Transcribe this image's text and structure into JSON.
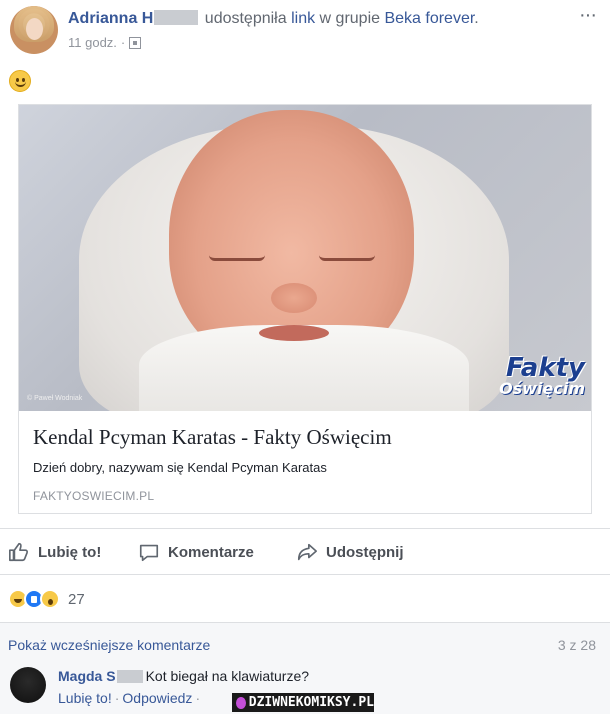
{
  "post": {
    "author": "Adrianna H",
    "verb_before_link": " udostępniła ",
    "link_word": "link",
    "in_group": " w grupie ",
    "group_name": "Beka forever",
    "group_suffix": ".",
    "time": "11 godz.",
    "time_sep": "·",
    "more": "···"
  },
  "link_card": {
    "title": "Kendal Pcyman Karatas - Fakty Oświęcim",
    "description": "Dzień dobry, nazywam się Kendal Pcyman Karatas",
    "domain": "FAKTYOSWIECIM.PL",
    "photo_credit": "© Paweł Wodniak",
    "brand_top": "Fakty",
    "brand_bottom": "Oświęcim"
  },
  "actions": {
    "like": "Lubię to!",
    "comment": "Komentarze",
    "share": "Udostępnij"
  },
  "reactions": {
    "icons": [
      "haha-icon",
      "like-icon",
      "wow-icon"
    ],
    "count": "27"
  },
  "comments": {
    "show_previous": "Pokaż wcześniejsze komentarze",
    "counter": "3 z 28",
    "items": [
      {
        "author": "Magda S",
        "text": "Kot biegał na klawiaturze?",
        "like": "Lubię to!",
        "reply": "Odpowiedz",
        "sep": "·"
      }
    ]
  },
  "watermark": "DZIWNEKOMIKSY.PL",
  "colors": {
    "link_blue": "#385898",
    "like_blue": "#2078f4",
    "text_gray": "#606770",
    "border": "#dddfe2"
  }
}
